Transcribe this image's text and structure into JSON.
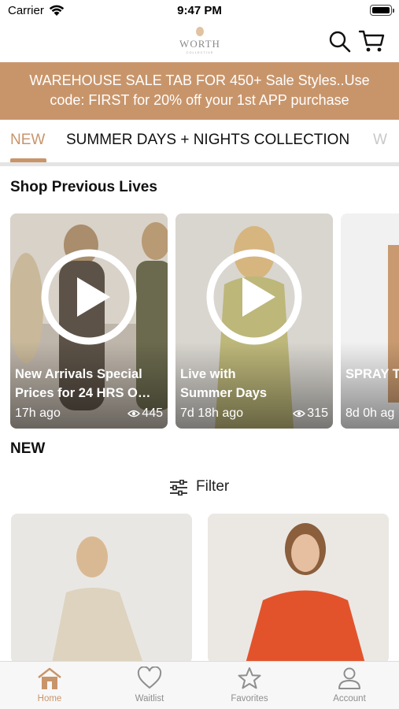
{
  "status_bar": {
    "carrier": "Carrier",
    "time": "9:47 PM",
    "icons": [
      "wifi-icon",
      "battery-icon"
    ]
  },
  "header": {
    "logo_text": "WORTH",
    "logo_subtext": "COLLECTIVE",
    "icons": [
      "search-icon",
      "cart-icon"
    ]
  },
  "promo": {
    "line1": "WAREHOUSE SALE TAB FOR 450+ Sale Styles..Use",
    "line2": "code: FIRST for 20% off your 1st APP purchase",
    "background": "#c8956b"
  },
  "tabs": [
    {
      "label": "NEW",
      "active": true
    },
    {
      "label": "SUMMER DAYS + NIGHTS COLLECTION",
      "active": false
    },
    {
      "label": "W",
      "active": false
    }
  ],
  "lives": {
    "heading": "Shop Previous Lives",
    "items": [
      {
        "title_line1": "New Arrivals Special",
        "title_line2": "Prices for 24 HRS O…",
        "time": "17h ago",
        "views": "445"
      },
      {
        "title_line1": "Live with",
        "title_line2": "Summer Days",
        "time": "7d 18h ago",
        "views": "315"
      },
      {
        "title_line1": "",
        "title_line2": "SPRAY T",
        "time": "8d 0h ag",
        "views": ""
      }
    ]
  },
  "new_section": {
    "heading": "NEW",
    "filter_label": "Filter"
  },
  "bottom_nav": [
    {
      "label": "Home",
      "icon": "home-icon",
      "active": true
    },
    {
      "label": "Waitlist",
      "icon": "heart-icon",
      "active": false
    },
    {
      "label": "Favorites",
      "icon": "star-icon",
      "active": false
    },
    {
      "label": "Account",
      "icon": "person-icon",
      "active": false
    }
  ],
  "colors": {
    "accent": "#c8956b",
    "inactive_icon": "#8e8e8e",
    "tab_muted": "#c9c9c9"
  }
}
